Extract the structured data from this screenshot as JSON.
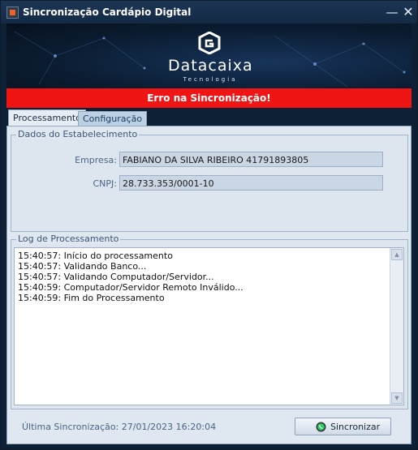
{
  "window": {
    "title": "Sincronização Cardápio Digital",
    "minimize_glyph": "—",
    "close_glyph": "✕"
  },
  "banner": {
    "brand": "Datacaixa",
    "tagline": "Tecnologia"
  },
  "status": {
    "message": "Erro na Sincronização!",
    "color": "#f01515"
  },
  "tabs": [
    {
      "label": "Processamento",
      "active": true
    },
    {
      "label": "Configuração",
      "active": false
    }
  ],
  "estabelecimento": {
    "title": "Dados do Estabelecimento",
    "empresa_label": "Empresa:",
    "empresa_value": "FABIANO DA SILVA RIBEIRO 41791893805",
    "cnpj_label": "CNPJ:",
    "cnpj_value": "28.733.353/0001-10"
  },
  "log": {
    "title": "Log de Processamento",
    "lines": [
      "15:40:57: Início do processamento",
      "15:40:57: Validando Banco...",
      "15:40:57: Validando Computador/Servidor...",
      "15:40:59: Computador/Servidor Remoto Inválido...",
      "15:40:59: Fim do Processamento"
    ]
  },
  "footer": {
    "last_sync": "Última Sincronização: 27/01/2023 16:20:04",
    "sync_button": "Sincronizar",
    "sync_icon": "whatsapp-icon"
  }
}
